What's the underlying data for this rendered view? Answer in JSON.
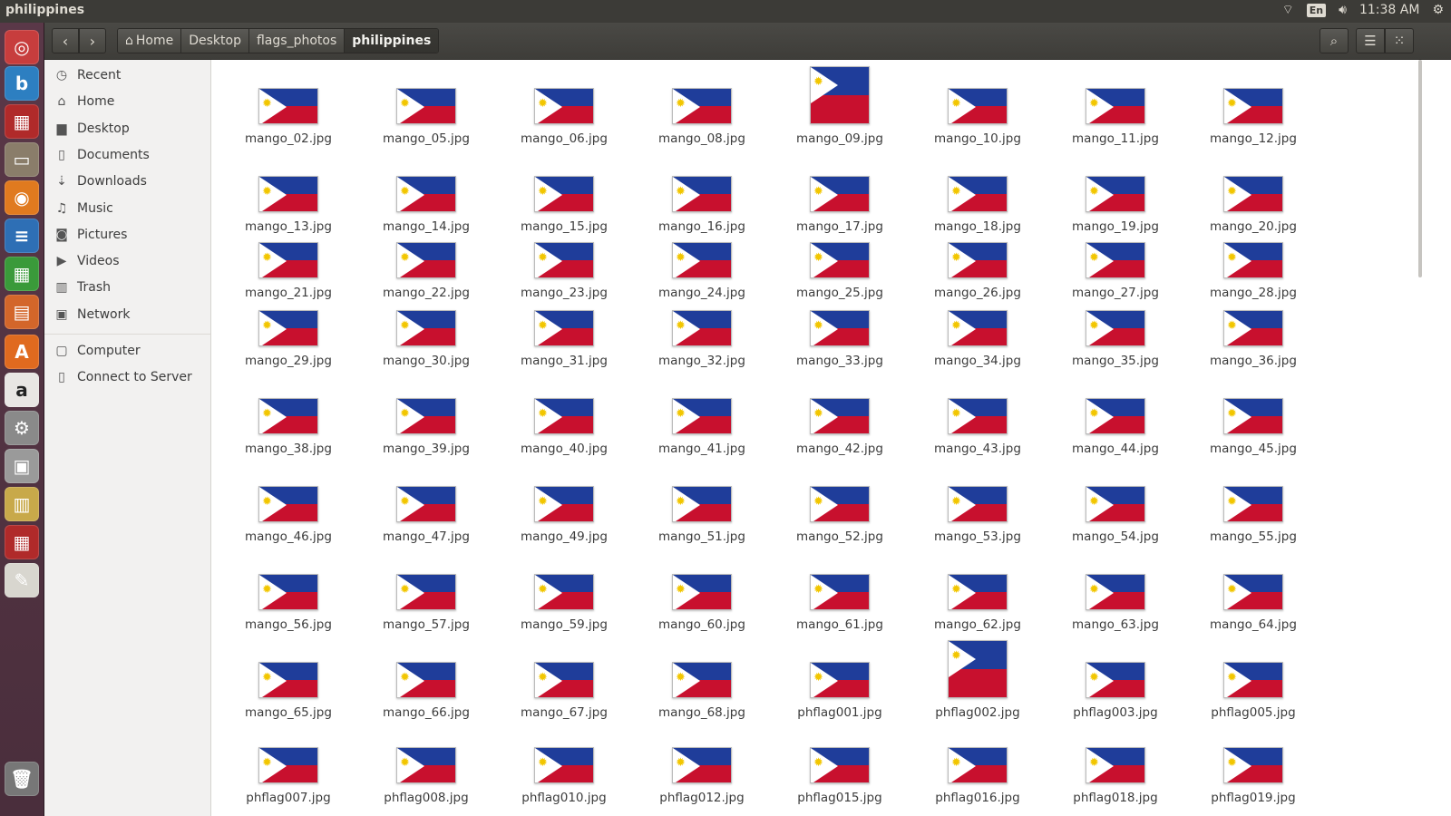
{
  "window": {
    "title": "philippines"
  },
  "panel": {
    "keyboard": "En",
    "time": "11:38 AM"
  },
  "launcher": {
    "items": [
      {
        "name": "dash-icon",
        "glyph": "◎",
        "color": "#c73d3d"
      },
      {
        "name": "bing-icon",
        "glyph": "b",
        "color": "#2d7fc1"
      },
      {
        "name": "presentation-app-icon",
        "glyph": "▦",
        "color": "#b02a2a"
      },
      {
        "name": "files-icon",
        "glyph": "▭",
        "color": "#8a7d6a"
      },
      {
        "name": "firefox-icon",
        "glyph": "◉",
        "color": "#e07a1f"
      },
      {
        "name": "writer-icon",
        "glyph": "≡",
        "color": "#2e6fb5"
      },
      {
        "name": "calc-icon",
        "glyph": "▦",
        "color": "#3a9a3a"
      },
      {
        "name": "impress-icon",
        "glyph": "▤",
        "color": "#d3662a"
      },
      {
        "name": "software-center-icon",
        "glyph": "A",
        "color": "#e06a1f"
      },
      {
        "name": "amazon-icon",
        "glyph": "a",
        "color": "#e8e6e3"
      },
      {
        "name": "settings-icon",
        "glyph": "⚙",
        "color": "#8a8a8a"
      },
      {
        "name": "usb-creator-icon",
        "glyph": "▣",
        "color": "#9a9a9a"
      },
      {
        "name": "archive-icon",
        "glyph": "▥",
        "color": "#c8a94a"
      },
      {
        "name": "remote-desktop-icon",
        "glyph": "▦",
        "color": "#b02a2a"
      },
      {
        "name": "text-editor-icon",
        "glyph": "✎",
        "color": "#d8d6cf"
      },
      {
        "name": "trash-icon",
        "glyph": "🗑",
        "color": "#777777"
      }
    ]
  },
  "toolbar": {
    "back": "‹",
    "forward": "›",
    "breadcrumbs": [
      "Home",
      "Desktop",
      "flags_photos",
      "philippines"
    ]
  },
  "sidebar": {
    "items": [
      {
        "label": "Recent",
        "icon": "clock-icon",
        "glyph": "◷"
      },
      {
        "label": "Home",
        "icon": "home-icon",
        "glyph": "⌂"
      },
      {
        "label": "Desktop",
        "icon": "folder-icon",
        "glyph": "▆"
      },
      {
        "label": "Documents",
        "icon": "document-icon",
        "glyph": "▯"
      },
      {
        "label": "Downloads",
        "icon": "download-icon",
        "glyph": "⇣"
      },
      {
        "label": "Music",
        "icon": "music-icon",
        "glyph": "♫"
      },
      {
        "label": "Pictures",
        "icon": "camera-icon",
        "glyph": "◙"
      },
      {
        "label": "Videos",
        "icon": "video-icon",
        "glyph": "▶"
      },
      {
        "label": "Trash",
        "icon": "trash-icon",
        "glyph": "▥"
      },
      {
        "label": "Network",
        "icon": "network-icon",
        "glyph": "▣"
      }
    ],
    "items2": [
      {
        "label": "Computer",
        "icon": "computer-icon",
        "glyph": "▢"
      },
      {
        "label": "Connect to Server",
        "icon": "server-icon",
        "glyph": "▯"
      }
    ]
  },
  "files": {
    "rows": [
      [
        "mango_02.jpg",
        "mango_05.jpg",
        "mango_06.jpg",
        "mango_08.jpg",
        "mango_09.jpg",
        "mango_10.jpg",
        "mango_11.jpg",
        "mango_12.jpg"
      ],
      [
        "mango_13.jpg",
        "mango_14.jpg",
        "mango_15.jpg",
        "mango_16.jpg",
        "mango_17.jpg",
        "mango_18.jpg",
        "mango_19.jpg",
        "mango_20.jpg"
      ],
      [
        "mango_21.jpg",
        "mango_22.jpg",
        "mango_23.jpg",
        "mango_24.jpg",
        "mango_25.jpg",
        "mango_26.jpg",
        "mango_27.jpg",
        "mango_28.jpg"
      ],
      [
        "mango_29.jpg",
        "mango_30.jpg",
        "mango_31.jpg",
        "mango_32.jpg",
        "mango_33.jpg",
        "mango_34.jpg",
        "mango_35.jpg",
        "mango_36.jpg"
      ],
      [
        "mango_38.jpg",
        "mango_39.jpg",
        "mango_40.jpg",
        "mango_41.jpg",
        "mango_42.jpg",
        "mango_43.jpg",
        "mango_44.jpg",
        "mango_45.jpg"
      ],
      [
        "mango_46.jpg",
        "mango_47.jpg",
        "mango_49.jpg",
        "mango_51.jpg",
        "mango_52.jpg",
        "mango_53.jpg",
        "mango_54.jpg",
        "mango_55.jpg"
      ],
      [
        "mango_56.jpg",
        "mango_57.jpg",
        "mango_59.jpg",
        "mango_60.jpg",
        "mango_61.jpg",
        "mango_62.jpg",
        "mango_63.jpg",
        "mango_64.jpg"
      ],
      [
        "mango_65.jpg",
        "mango_66.jpg",
        "mango_67.jpg",
        "mango_68.jpg",
        "phflag001.jpg",
        "phflag002.jpg",
        "phflag003.jpg",
        "phflag005.jpg"
      ],
      [
        "phflag007.jpg",
        "phflag008.jpg",
        "phflag010.jpg",
        "phflag012.jpg",
        "phflag015.jpg",
        "phflag016.jpg",
        "phflag018.jpg",
        "phflag019.jpg"
      ]
    ]
  },
  "colors": {
    "flag_blue": "#1f3d9a",
    "flag_red": "#c8102e",
    "flag_sun": "#f2c600"
  }
}
